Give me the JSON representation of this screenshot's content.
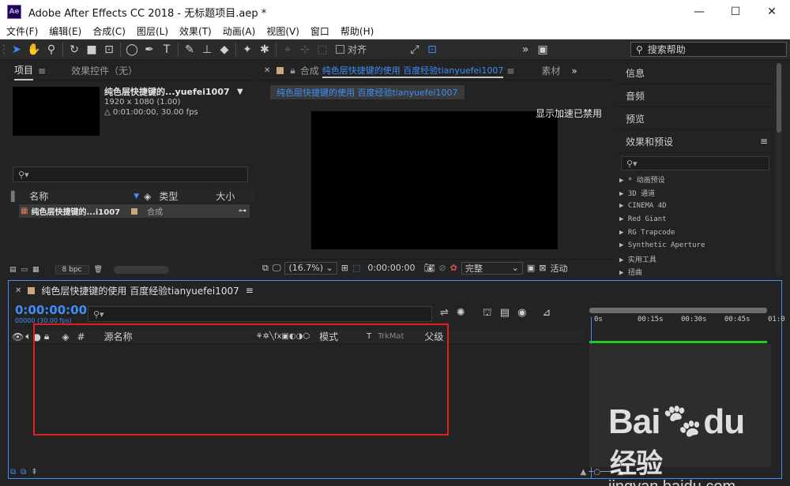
{
  "window": {
    "app_logo": "Ae",
    "title": "Adobe After Effects CC 2018 - 无标题项目.aep *",
    "controls": [
      "—",
      "☐",
      "✕"
    ]
  },
  "menu": [
    "文件(F)",
    "编辑(E)",
    "合成(C)",
    "图层(L)",
    "效果(T)",
    "动画(A)",
    "视图(V)",
    "窗口",
    "帮助(H)"
  ],
  "toolbar": {
    "align_label": "对齐",
    "search_placeholder": "搜索帮助"
  },
  "project_panel": {
    "tab_project": "项目",
    "tab_effects": "效果控件（无）",
    "item_name": "纯色层快捷键的...yuefei1007",
    "resolution": "1920 x 1080 (1.00)",
    "duration": "△ 0:01:00:00, 30.00 fps",
    "search_glyph": "⚲▾",
    "col_name": "名称",
    "col_type": "类型",
    "col_size": "大小",
    "row_name": "纯色层快捷键的...i1007",
    "row_type": "合成",
    "bpc": "8 bpc"
  },
  "comp_panel": {
    "tab_prefix": "合成",
    "tab_name": "纯色层快捷键的使用 百度经验tianyuefei1007",
    "tab_more": "素材",
    "sub_tab": "纯色层快捷键的使用 百度经验tianyuefei1007",
    "gpu_message": "显示加速已禁用",
    "zoom": "(16.7%)",
    "timecode": "0:00:00:00",
    "quality": "完整",
    "active_label": "活动"
  },
  "right_panel": {
    "info": "信息",
    "audio": "音频",
    "preview": "预览",
    "effects_presets": "效果和预设",
    "search_glyph": "⚲▾",
    "fx_items": [
      "▶ * 动画预设",
      "▶ 3D 通道",
      "▶ CINEMA 4D",
      "▶ Red Giant",
      "▶ RG Trapcode",
      "▶ Synthetic Aperture",
      "▶ 实用工具",
      "▶ 扭曲"
    ]
  },
  "timeline": {
    "comp_name": "纯色层快捷键的使用 百度经验tianyuefei1007",
    "timecode": "0:00:00:00",
    "subcode": "00000 (30.00 fps)",
    "search_glyph": "⚲▾",
    "col_hash": "#",
    "col_source": "源名称",
    "col_mode": "模式",
    "col_t": "T",
    "col_trkmat": "TrkMat",
    "col_parent": "父级",
    "ticks": [
      "0s",
      "00:15s",
      "00:30s",
      "00:45s",
      "01:0"
    ]
  },
  "watermark": {
    "logo": "Bai",
    "logo_cn": "经验",
    "url": "jingyan.baidu.com"
  },
  "colors": {
    "accent_blue": "#3e8ef7",
    "highlight_red": "#e02020",
    "work_area_green": "#1ecf1e"
  }
}
